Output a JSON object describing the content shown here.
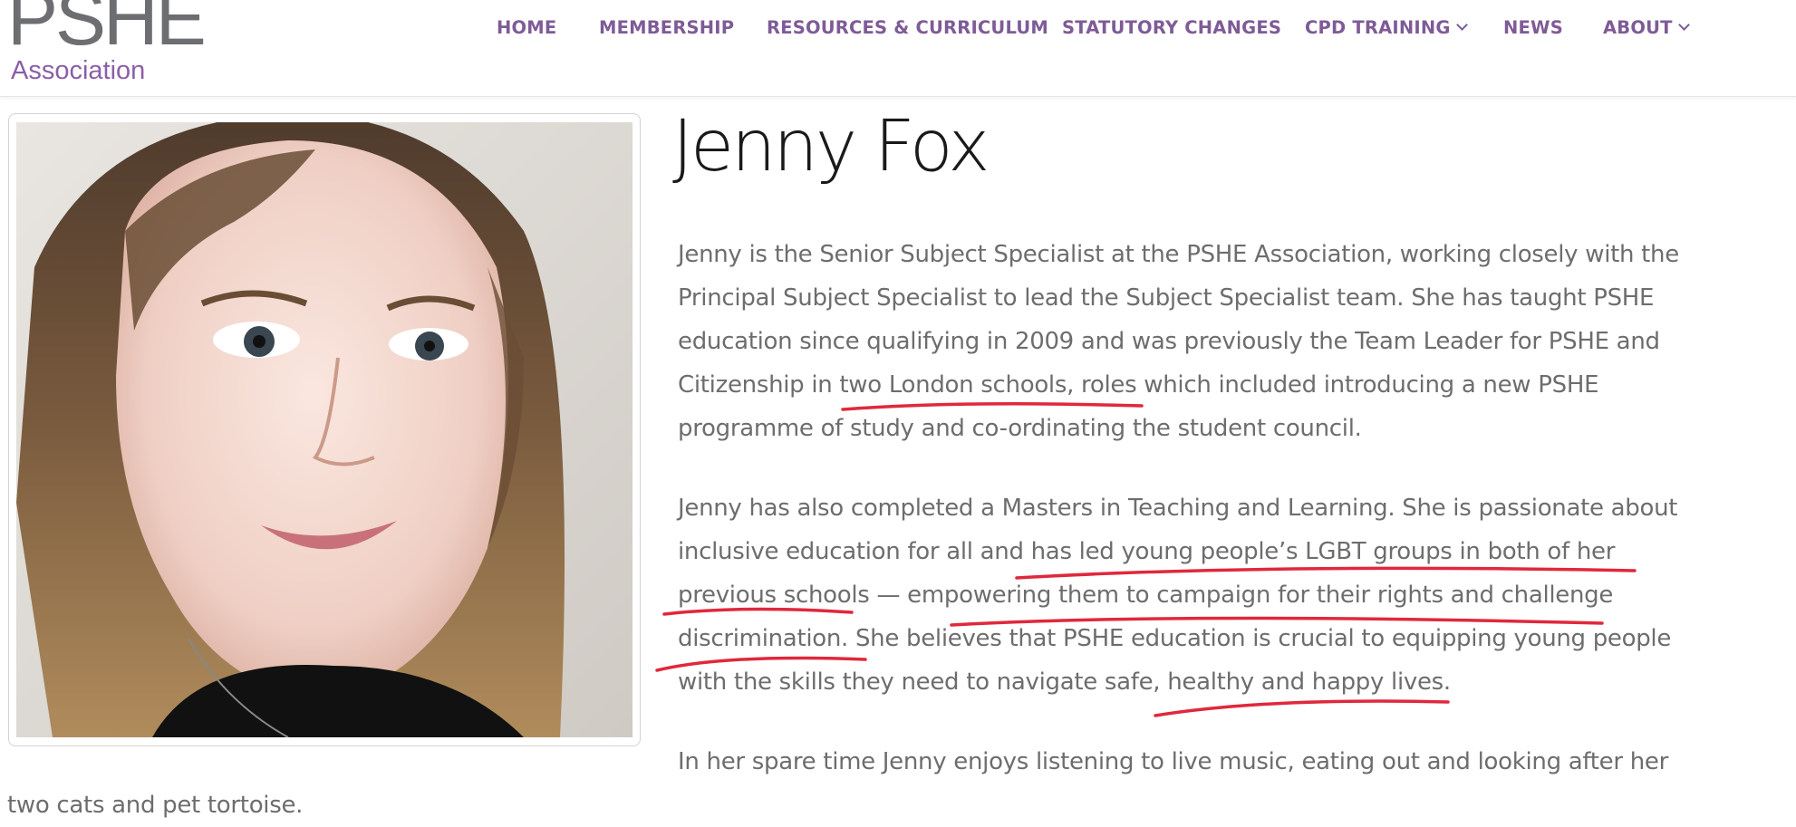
{
  "logo": {
    "big": "PSHE",
    "small": "Association"
  },
  "nav": {
    "items": [
      {
        "label": "HOME",
        "dropdown": false
      },
      {
        "label": "MEMBERSHIP",
        "dropdown": false
      },
      {
        "label": "RESOURCES & CURRICULUM",
        "dropdown": false
      },
      {
        "label": "STATUTORY CHANGES",
        "dropdown": false
      },
      {
        "label": "CPD TRAINING",
        "dropdown": true
      },
      {
        "label": "NEWS",
        "dropdown": false
      },
      {
        "label": "ABOUT",
        "dropdown": true
      }
    ]
  },
  "profile": {
    "name": "Jenny Fox",
    "photo_icon": "portrait-photo",
    "bio": {
      "p1": [
        "Jenny is the Senior Subject Specialist at the PSHE Association, working closely with the",
        "Principal Subject Specialist to lead the Subject Specialist team. She has taught PSHE",
        "education since qualifying in 2009 and was previously the Team Leader for PSHE and",
        "Citizenship in two London schools, roles which included introducing a new PSHE",
        "programme of study and co-ordinating the student council."
      ],
      "p2": [
        "Jenny has also completed a Masters in Teaching and Learning. She is passionate about",
        "inclusive education for all and has led young people’s LGBT groups in both of her",
        "previous schools — empowering them to campaign for their rights and challenge",
        "discrimination. She believes that PSHE education is crucial to equipping young people",
        "with the skills they need to navigate safe, healthy and happy lives."
      ],
      "p3": [
        "In her spare time Jenny enjoys listening to live music, eating out and looking after her",
        "two cats and pet tortoise."
      ]
    }
  },
  "colors": {
    "brand_purple": "#7e5b97",
    "logo_gray": "#6d6e71",
    "body_text": "#6d6d6d",
    "annotation_red": "#e0283c"
  }
}
